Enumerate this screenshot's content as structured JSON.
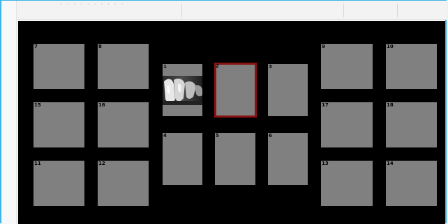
{
  "toolbar": {
    "faded_text": "· · · · · · · · · ·"
  },
  "slots": [
    {
      "label": "7",
      "kind": "empty"
    },
    {
      "label": "8",
      "kind": "empty"
    },
    {
      "label": "1",
      "kind": "image",
      "image_icon": "dental-xray-image"
    },
    {
      "label": "2",
      "kind": "selected"
    },
    {
      "label": "3",
      "kind": "empty"
    },
    {
      "label": "9",
      "kind": "empty"
    },
    {
      "label": "10",
      "kind": "empty"
    },
    {
      "label": "15",
      "kind": "empty"
    },
    {
      "label": "16",
      "kind": "empty"
    },
    {
      "label": "4",
      "kind": "empty"
    },
    {
      "label": "5",
      "kind": "empty"
    },
    {
      "label": "6",
      "kind": "empty"
    },
    {
      "label": "17",
      "kind": "empty"
    },
    {
      "label": "18",
      "kind": "empty"
    },
    {
      "label": "11",
      "kind": "empty"
    },
    {
      "label": "12",
      "kind": "empty"
    },
    {
      "label": "13",
      "kind": "empty"
    },
    {
      "label": "14",
      "kind": "empty"
    }
  ],
  "colors": {
    "canvas": "#000000",
    "slot": "#808080",
    "selected_border": "#8a1212",
    "window_border": "#3cb4e6"
  }
}
